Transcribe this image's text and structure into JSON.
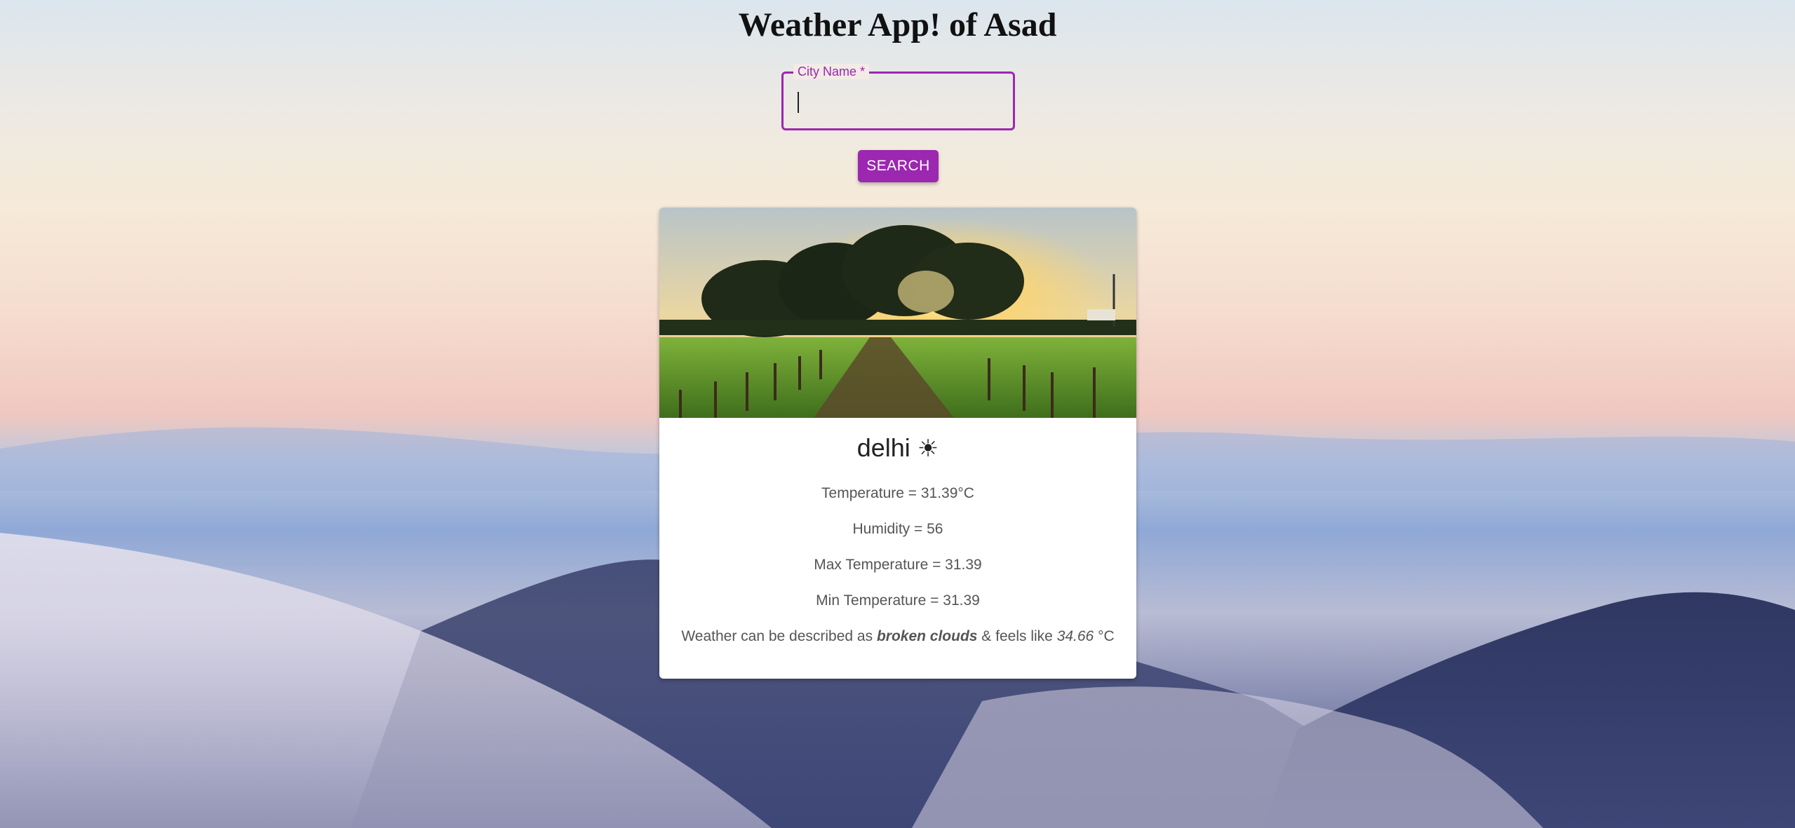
{
  "app": {
    "title": "Weather App! of Asad"
  },
  "search": {
    "label": "City Name *",
    "value": "",
    "button_label": "SEARCH"
  },
  "weather": {
    "city": "delhi",
    "icon": "sun-icon",
    "temperature_text": "Temperature = 31.39°C",
    "humidity_text": "Humidity = 56",
    "max_temp_text": "Max Temperature = 31.39",
    "min_temp_text": "Min Temperature = 31.39",
    "description_prefix": "Weather can be described as ",
    "description": "broken clouds",
    "feels_prefix": " & feels like ",
    "feels_like": "34.66",
    "feels_suffix": " °C"
  },
  "colors": {
    "accent": "#9c27b0"
  }
}
